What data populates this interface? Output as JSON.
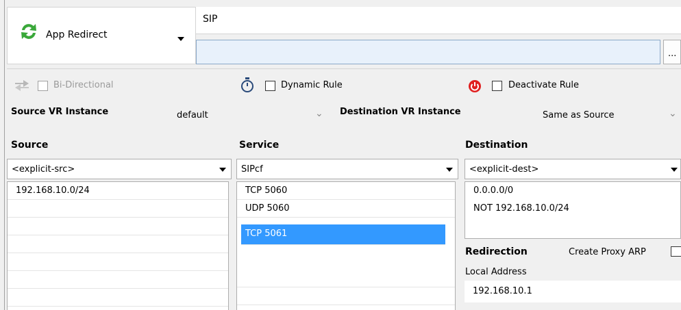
{
  "rule_type": {
    "label": "App Redirect",
    "icon": "redirect-arrows-icon",
    "icon_color": "#3aa83a"
  },
  "name_field": {
    "value": "SIP"
  },
  "comment_field": {
    "value": "",
    "browse_label": "..."
  },
  "options": {
    "bidirectional": {
      "label": "Bi-Directional",
      "checked": false,
      "enabled": false
    },
    "dynamic": {
      "label": "Dynamic Rule",
      "checked": false
    },
    "deactivate": {
      "label": "Deactivate Rule",
      "checked": false,
      "icon_color": "#e02020"
    }
  },
  "vr": {
    "source_label": "Source VR Instance",
    "source_value": "default",
    "dest_label": "Destination VR Instance",
    "dest_value": "Same as Source"
  },
  "source": {
    "header": "Source",
    "selector": "<explicit-src>",
    "items": [
      "192.168.10.0/24"
    ]
  },
  "service": {
    "header": "Service",
    "selector": "SIPcf",
    "items": [
      "TCP  5060",
      "UDP  5060",
      "TCP  5061"
    ],
    "selected_index": 2
  },
  "destination": {
    "header": "Destination",
    "selector": "<explicit-dest>",
    "items": [
      "0.0.0.0/0",
      "NOT 192.168.10.0/24"
    ]
  },
  "redirection": {
    "header": "Redirection",
    "proxy_arp_label": "Create Proxy ARP",
    "local_address_label": "Local Address",
    "local_address_value": "192.168.10.1"
  },
  "colors": {
    "selection": "#3399ff",
    "comment_bg": "#e8f1fb"
  }
}
